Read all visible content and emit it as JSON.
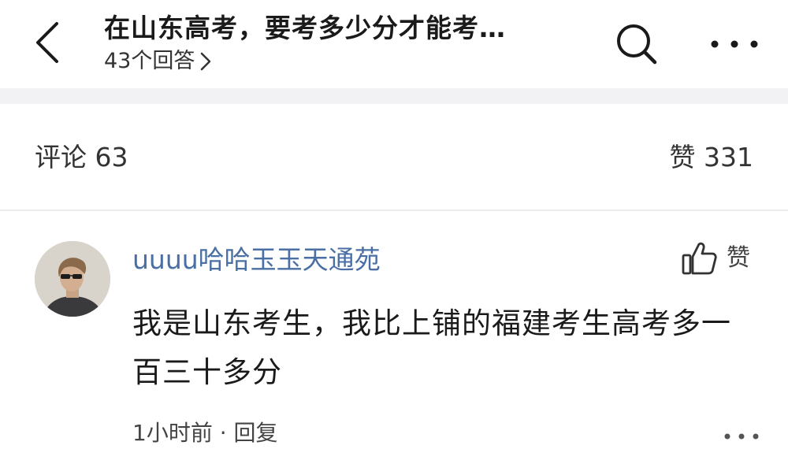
{
  "header": {
    "title": "在山东高考，要考多少分才能考…",
    "answer_count": "43个回答"
  },
  "stats": {
    "comments_label": "评论",
    "comments_count": "63",
    "likes_label": "赞",
    "likes_count": "331"
  },
  "comment": {
    "username": "uuuu哈哈玉玉天通苑",
    "like_label": "赞",
    "text": "我是山东考生，我比上铺的福建考生高考多一百三十多分",
    "time": "1小时前",
    "separator": "·",
    "reply_label": "回复"
  },
  "icons": {
    "back": "chevron-left-icon",
    "search": "search-icon",
    "more": "more-horizontal-icon",
    "thumbs_up": "thumbs-up-icon",
    "answers_chevron": "chevron-right-icon"
  },
  "colors": {
    "username": "#4a6fa5",
    "band": "#f2f2f4",
    "text": "#1a1a1a"
  }
}
